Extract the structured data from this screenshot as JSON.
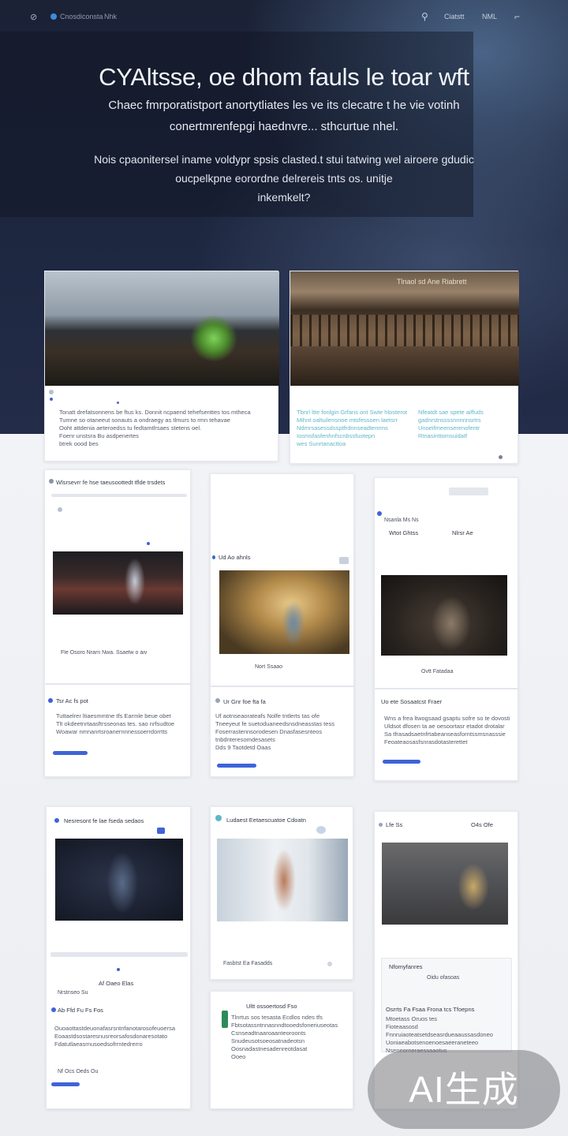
{
  "nav": {
    "brand": "Cnosdiconsta",
    "link": "Nhk",
    "right1": "Ciatstt",
    "right2": "NML"
  },
  "hero": {
    "title": "CYAltsse, oe dhom fauls le toar wft",
    "sub_line1": "Chaec fmrporatistport anortytliates les ve its clecatre t he vie votinh",
    "sub_line2": "conertmrenfepgi haednvre... sthcurtue nhel.",
    "desc_line1": "Nois cpaonitersel iname voldypr spsis clasted.t stui tatwing wel airoere gdudic",
    "desc_line2": "oucpelkpne eorordne delrereis tnts os. unitje",
    "desc_line3": "inkemkelt?"
  },
  "cards": {
    "c1": {
      "lines": [
        "Tonatt drefatsonnens be ftus ks. Donnit ncpaend tehefsenttes tos mtheca",
        "Tumne so otaneeut sonauts a ondraegy as tlmurs to rmn tehavae",
        "Ooht attdenia aeteroedss tu fedtamtlrsaes stetens oel.",
        "Foenr unstsra Bu asdpenertes",
        "btrek oood bes"
      ]
    },
    "c2": {
      "overlay": "Tlnaol sd Ane Riabrett",
      "lines": [
        "Tbnrl ltte fonlgin Grfans ont Swte hlosterot",
        "Mihnt oaltuilensnoe mtsfessoen laetsrr",
        "Ndmrsasessdssptfrdnnseadtenrms",
        "Iosmsfasfenhnfscnbssfuotepn",
        "wes Sunrtanacttoa"
      ],
      "side": [
        "Nfeatdt sae spete aiffuds",
        "gadnrstnssssnnnnnsrtrs",
        "Unoeifmeenserenofentr",
        "Rtnasinttomsuidatf"
      ]
    },
    "c3": {
      "head": "Wlsrsevrr fe hse taeusoottedt tflde trsdets",
      "caption": "Fle Osoro Nrarn Nwa. Ssaelw o aiv",
      "head2": "Tsr Ac fs pot",
      "lines": [
        "Tuttaelrer ltiaesmmtne tfs Earmle beue obet",
        "Tlt okdeetnrtaasftrsseonas tes. sao nrfsudtoe",
        "Woawar nmnanrtsroanernnnessoerrdorrtts"
      ]
    },
    "c4": {
      "head": "Ud Ao ahnls",
      "caption": "Nort Ssaao",
      "head2": "Ur Gnr foe fta fa",
      "lines": [
        "Uf aotnseaorateafs Nolfe tntlerts tas ofe",
        "Tneeyeut fe suetoduaneedsnsdneasstas tess",
        "Foserrastennsorodesen Dnasfasesnteos",
        "tnbdnteresomdesasets",
        "Dds 9 Taotdetd Oaas"
      ]
    },
    "c5": {
      "head": "Wtot Ghtss",
      "head_right": "Nlrsr Ae",
      "top_meta": "Nsanla Ms Ns",
      "caption": "Ovtt Fatadaa",
      "head2": "Uo ete Sosaatcst Fraer",
      "lines": [
        "Wns a frea ltwogsaad gsaptu sofre so te dovosti",
        "Uldsot dfosen ta ae oesoortasr etadot drotalar",
        "Sa tfrasadsaetnfrtabeanseasforntssmsnasssie",
        "Feoateaosasfsnrasdotasterettet"
      ]
    },
    "c6": {
      "head": "Nesresont fe lae fseda sedaos",
      "caption": "Af Oaeo Elas",
      "sub": "Nrstnseo Su",
      "head2": "Ab Ffd Fu Fs Fos",
      "lines": [
        "Ouoaottastdeuonafasrsntnfanotarosofeuoersa",
        "Eoaastdsostaresnusreorsafosdonaresotato",
        "Fdatutlaeasrnusoedsofrrntedrerro"
      ],
      "foot": "Nf Ocs Oeds Ou"
    },
    "c7": {
      "head": "Ludaest Eetaescuatoe Cdoatn",
      "caption": "Fasbtst Ea Fasadds",
      "head2": "Ultt ossoertosd Fso",
      "lines": [
        "Tlnrtus sos tesasta Ecdlos ndes tfs",
        "Fbtsotassntnnasnndtooedsfoneriuseotas",
        "Csnseadtnaaroaanteoroonts",
        "Snudeusotsoeosatnadeotsn",
        "Oosnadastnesadenreotdasat",
        "Ooeo"
      ]
    },
    "c8": {
      "head": "Lfe Ss",
      "head_right": "O4s Ofe",
      "caption": "Nfomyfanres",
      "sub": "Oidu ofasoas",
      "head2": "Osrrts Fa Fsaa Frona tcs Tfoepns",
      "lines": [
        "Mtoetass Oruos tes",
        "Fioteaasosd",
        "Fnnruiaoteatsetdseasrdueaaussasdoneo",
        "Uoniaeabotsenoenoesaeeraneteeo",
        "Nseneorneraessaaotus"
      ]
    }
  },
  "watermark": "AI生成",
  "colors": {
    "accent": "#3f63d8",
    "hero_bg": "#1e2740",
    "teal_text": "#5fb6c9"
  }
}
